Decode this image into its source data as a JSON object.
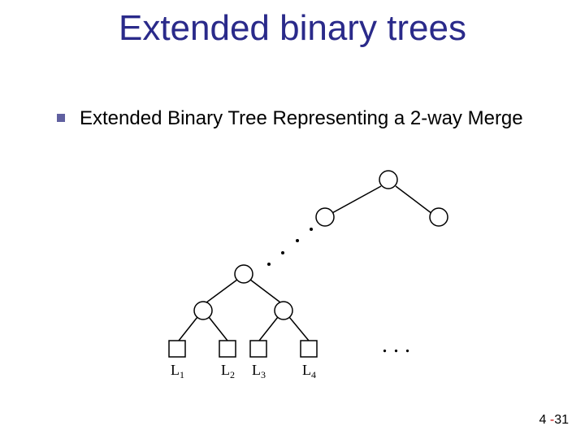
{
  "title": "Extended binary trees",
  "bullet": "Extended Binary Tree Representing a 2-way Merge",
  "labels": {
    "l1": "L",
    "l1s": "1",
    "l2": "L",
    "l2s": "2",
    "l3": "L",
    "l3s": "3",
    "l4": "L",
    "l4s": "4"
  },
  "ellipsis_lower": ". . .",
  "page": {
    "chapter": "4",
    "dash": " -",
    "num": "31"
  }
}
